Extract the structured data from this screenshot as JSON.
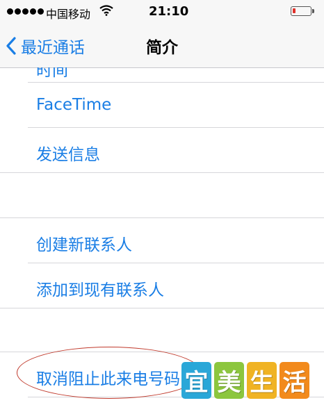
{
  "status_bar": {
    "carrier": "中国移动",
    "time": "21:10",
    "signal_dots": 5,
    "battery_level": "low"
  },
  "nav": {
    "back_label": "最近通话",
    "title": "简介"
  },
  "list": {
    "partial_item": "时间",
    "facetime": "FaceTime",
    "send_message": "发送信息",
    "create_contact": "创建新联系人",
    "add_to_existing": "添加到现有联系人",
    "unblock_caller": "取消阻止此来电号码"
  },
  "watermark": {
    "chars": [
      "宜",
      "美",
      "生",
      "活"
    ],
    "colors": [
      "#2aa7d8",
      "#8cc63e",
      "#f0b323",
      "#f28a1c"
    ]
  },
  "colors": {
    "ios_blue": "#1a7ee5",
    "annotation_red": "#c0392b"
  }
}
